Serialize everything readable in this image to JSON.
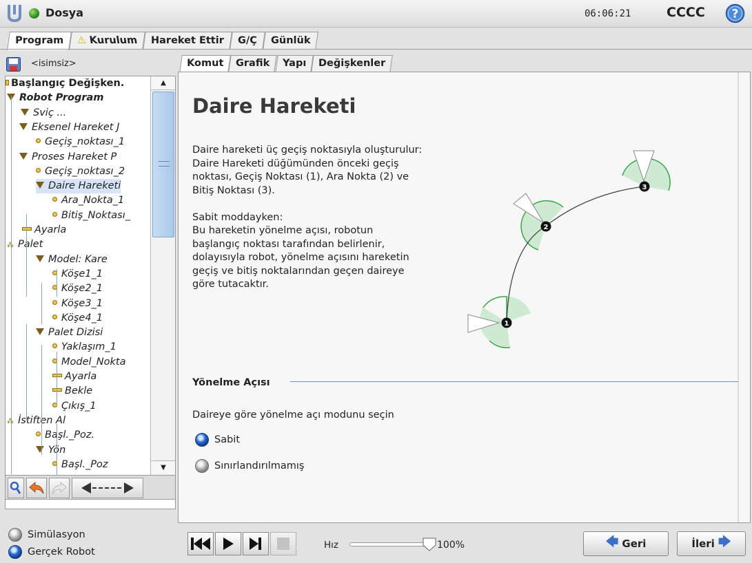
{
  "header": {
    "file_menu": "Dosya",
    "clock": "06:06:21",
    "robot_name": "CCCC"
  },
  "main_tabs": [
    {
      "label": "Program",
      "active": true
    },
    {
      "label": "Kurulum",
      "warning": true
    },
    {
      "label": "Hareket Ettir"
    },
    {
      "label": "G/Ç"
    },
    {
      "label": "Günlük"
    }
  ],
  "program": {
    "name": "<isimsiz>"
  },
  "tree": [
    {
      "label": "Başlangıç Değişken.",
      "style": "bold",
      "icon": "small-square"
    },
    {
      "label": "Robot Program",
      "style": "boldi",
      "icon": "triangle"
    },
    {
      "label": "Sviç ...",
      "style": "italic",
      "icon": "triangle"
    },
    {
      "label": "Eksenel Hareket J",
      "style": "italic",
      "icon": "triangle"
    },
    {
      "label": "Geçiş_noktası_1",
      "style": "italic",
      "icon": "waypoint"
    },
    {
      "label": "Proses Hareket P",
      "style": "italic",
      "icon": "triangle"
    },
    {
      "label": "Geçiş_noktası_2",
      "style": "italic",
      "icon": "waypoint"
    },
    {
      "label": "Daire Hareketi",
      "style": "italic",
      "icon": "triangle",
      "selected": true
    },
    {
      "label": "Ara_Nokta_1",
      "style": "italic",
      "icon": "waypoint"
    },
    {
      "label": "Bitiş_Noktası_",
      "style": "italic",
      "icon": "waypoint"
    },
    {
      "label": "Ayarla",
      "style": "italic",
      "icon": "bar"
    },
    {
      "label": "Palet",
      "style": "italic",
      "icon": "pallet"
    },
    {
      "label": "Model: Kare",
      "style": "italic",
      "icon": "triangle"
    },
    {
      "label": "Köşe1_1",
      "style": "italic",
      "icon": "waypoint"
    },
    {
      "label": "Köşe2_1",
      "style": "italic",
      "icon": "waypoint"
    },
    {
      "label": "Köşe3_1",
      "style": "italic",
      "icon": "waypoint"
    },
    {
      "label": "Köşe4_1",
      "style": "italic",
      "icon": "waypoint"
    },
    {
      "label": "Palet Dizisi",
      "style": "italic",
      "icon": "triangle"
    },
    {
      "label": "Yaklaşım_1",
      "style": "italic",
      "icon": "waypoint"
    },
    {
      "label": "Model_Nokta",
      "style": "italic",
      "icon": "waypoint"
    },
    {
      "label": "Ayarla",
      "style": "italic",
      "icon": "bar"
    },
    {
      "label": "Bekle",
      "style": "italic",
      "icon": "bar"
    },
    {
      "label": "Çıkış_1",
      "style": "italic",
      "icon": "waypoint"
    },
    {
      "label": "İstiften Al",
      "style": "italic",
      "icon": "pallet"
    },
    {
      "label": "Başl._Poz.",
      "style": "italic",
      "icon": "waypoint"
    },
    {
      "label": "Yön",
      "style": "italic",
      "icon": "triangle"
    },
    {
      "label": "Başl._Poz",
      "style": "italic",
      "icon": "waypoint"
    }
  ],
  "command_tabs": [
    {
      "label": "Komut",
      "active": true
    },
    {
      "label": "Grafik"
    },
    {
      "label": "Yapı"
    },
    {
      "label": "Değişkenler"
    }
  ],
  "command": {
    "title": "Daire Hareketi",
    "description": "Daire hareketi üç geçiş noktasıyla oluşturulur:\nDaire Hareketi düğümünden önceki geçiş\nnoktası, Geçiş Noktası (1), Ara Nokta (2) ve\nBitiş Noktası (3).\n\nSabit moddayken:\nBu hareketin yönelme açısı, robotun\nbaşlangıç noktası tarafından belirlenir,\ndolayısıyla robot, yönelme açısını hareketin\ngeçiş ve bitiş noktalarından geçen daireye\ngöre tutacaktır.",
    "diagram_points": [
      "1",
      "2",
      "3"
    ],
    "section_label": "Yönelme Açısı",
    "choose_text": "Daireye göre yönelme açı modunu seçin",
    "options": [
      {
        "label": "Sabit",
        "selected": true
      },
      {
        "label": "Sınırlandırılmamış",
        "selected": false
      }
    ]
  },
  "bottom": {
    "modes": [
      {
        "label": "Simülasyon",
        "selected": false
      },
      {
        "label": "Gerçek Robot",
        "selected": true
      }
    ],
    "speed_label": "Hız",
    "speed_value": "100%",
    "speed_fraction": 1.0,
    "back_label": "Geri",
    "next_label": "İleri"
  },
  "colors": {
    "accent_blue": "#3d6fc7",
    "arc_green": "#3aa64a",
    "selected_row": "#d6e4f5"
  }
}
